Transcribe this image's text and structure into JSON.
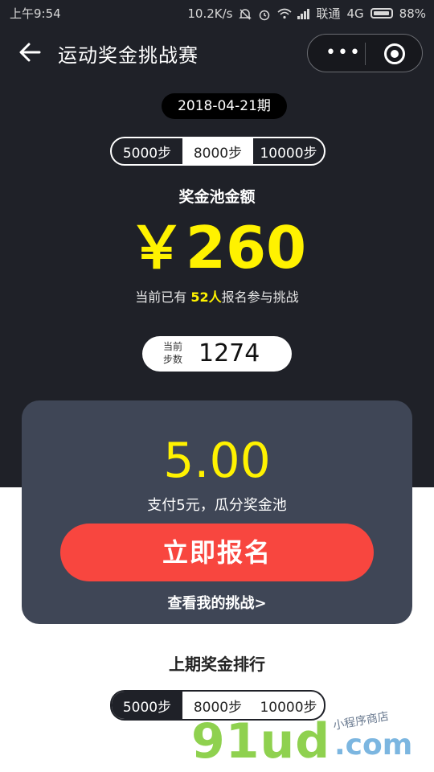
{
  "status_bar": {
    "time": "上午9:54",
    "net_speed": "10.2K/s",
    "carrier": "联通",
    "network": "4G",
    "battery": "88%"
  },
  "nav": {
    "title": "运动奖金挑战赛",
    "more_glyph": "•••",
    "icons": [
      "back-arrow-icon",
      "more-icon",
      "target-icon"
    ]
  },
  "period": "2018-04-21期",
  "step_tabs_top": {
    "options": [
      "5000步",
      "8000步",
      "10000步"
    ],
    "selected": "8000步"
  },
  "pool": {
    "label": "奖金池金额",
    "amount": "￥260",
    "participants_prefix": "当前已有 ",
    "participants_count": "52人",
    "participants_suffix": "报名参与挑战"
  },
  "current_steps": {
    "label": "当前步数",
    "value": "1274"
  },
  "card": {
    "fee": "5.00",
    "fee_desc": "支付5元，瓜分奖金池",
    "signup_label": "立即报名",
    "my_challenge_link": "查看我的挑战>"
  },
  "ranking": {
    "title": "上期奖金排行",
    "options": [
      "5000步",
      "8000步",
      "10000步"
    ],
    "selected": "5000步"
  },
  "watermark": {
    "brand": "91ud",
    "suffix": ".com",
    "tagline": "小程序商店"
  },
  "colors": {
    "dark_bg": "#1f2128",
    "accent_yellow": "#fff200",
    "signup_red": "#f8463f",
    "card_bg": "#3f4656"
  }
}
